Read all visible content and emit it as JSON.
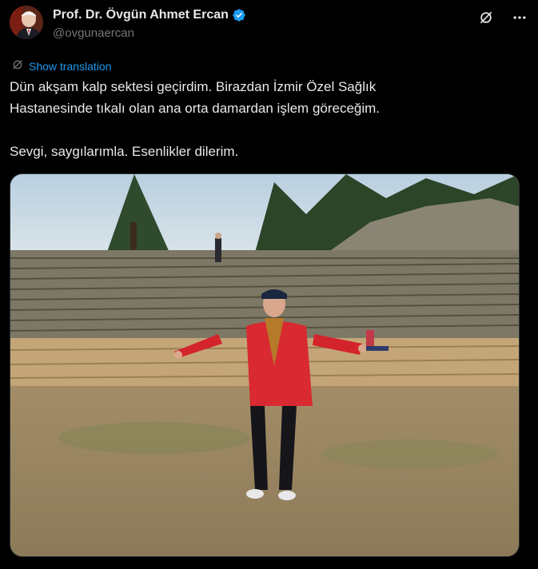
{
  "author": {
    "name": "Prof. Dr. Övgün Ahmet Ercan",
    "handle": "@ovgunaercan",
    "verified_icon": "verified-badge-icon"
  },
  "header_actions": {
    "grok_icon": "grok-icon",
    "more_icon": "more-icon"
  },
  "translation": {
    "label": "Show translation"
  },
  "tweet": {
    "line1": "Dün akşam kalp sektesi geçirdim. Birazdan İzmir Özel Sağlık",
    "line2": "Hastanesinde tıkalı olan ana orta damardan işlem göreceğim.",
    "line3": "Sevgi, saygılarımla. Esenlikler dilerim."
  },
  "colors": {
    "background": "#000000",
    "text": "#e7e9ea",
    "secondary": "#71767b",
    "link": "#1d9bf0"
  }
}
